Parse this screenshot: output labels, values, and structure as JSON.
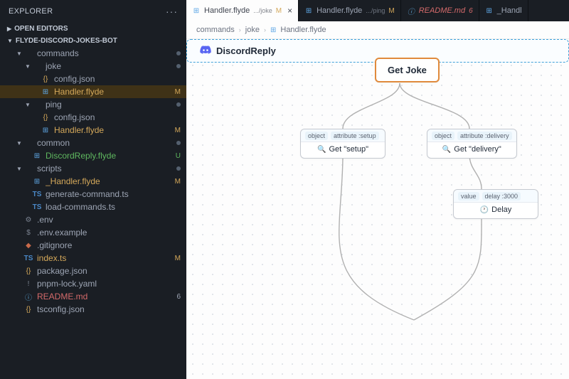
{
  "sidebar": {
    "title": "EXPLORER",
    "openEditors": "OPEN EDITORS",
    "project": "FLYDE-DISCORD-JOKES-BOT",
    "tree": [
      {
        "label": "commands",
        "kind": "folder",
        "indent": 1,
        "open": true,
        "dot": true
      },
      {
        "label": "joke",
        "kind": "folder",
        "indent": 2,
        "open": true,
        "dot": true
      },
      {
        "label": "config.json",
        "kind": "json",
        "indent": 3
      },
      {
        "label": "Handler.flyde",
        "kind": "flyde",
        "indent": 3,
        "status": "M",
        "active": true,
        "mod": true
      },
      {
        "label": "ping",
        "kind": "folder",
        "indent": 2,
        "open": true,
        "dot": true
      },
      {
        "label": "config.json",
        "kind": "json",
        "indent": 3
      },
      {
        "label": "Handler.flyde",
        "kind": "flyde",
        "indent": 3,
        "status": "M",
        "mod": true
      },
      {
        "label": "common",
        "kind": "folder",
        "indent": 1,
        "open": true,
        "dot": true
      },
      {
        "label": "DiscordReply.flyde",
        "kind": "flyde",
        "indent": 2,
        "status": "U",
        "untracked": true
      },
      {
        "label": "scripts",
        "kind": "folder",
        "indent": 1,
        "open": true,
        "dot": true
      },
      {
        "label": "_Handler.flyde",
        "kind": "flyde",
        "indent": 2,
        "status": "M",
        "mod": true
      },
      {
        "label": "generate-command.ts",
        "kind": "ts",
        "indent": 2
      },
      {
        "label": "load-commands.ts",
        "kind": "ts",
        "indent": 2
      },
      {
        "label": ".env",
        "kind": "gear",
        "indent": 1
      },
      {
        "label": ".env.example",
        "kind": "dollar",
        "indent": 1
      },
      {
        "label": ".gitignore",
        "kind": "git",
        "indent": 1
      },
      {
        "label": "index.ts",
        "kind": "ts",
        "indent": 1,
        "status": "M",
        "mod": true
      },
      {
        "label": "package.json",
        "kind": "json",
        "indent": 1
      },
      {
        "label": "pnpm-lock.yaml",
        "kind": "lock",
        "indent": 1
      },
      {
        "label": "README.md",
        "kind": "info",
        "indent": 1,
        "status": "6",
        "deleted": true
      },
      {
        "label": "tsconfig.json",
        "kind": "json",
        "indent": 1
      }
    ]
  },
  "tabs": [
    {
      "icon": "flyde",
      "name": "Handler.flyde",
      "path": ".../joke",
      "mark": "M",
      "markClass": "m-mod",
      "active": true,
      "close": true
    },
    {
      "icon": "flyde",
      "name": "Handler.flyde",
      "path": ".../ping",
      "mark": "M",
      "markClass": "m-mod"
    },
    {
      "icon": "info",
      "name": "README.md",
      "mark": "6",
      "markClass": "m-num",
      "readme": true
    },
    {
      "icon": "flyde",
      "name": "_Handl",
      "trunc": true
    }
  ],
  "breadcrumb": {
    "parts": [
      "commands",
      "joke"
    ],
    "file": "Handler.flyde"
  },
  "nodes": {
    "getJoke": "Get Joke",
    "setup": {
      "ports": [
        "object",
        "attribute :setup"
      ],
      "body": "Get \"setup\""
    },
    "delivery": {
      "ports": [
        "object",
        "attribute :delivery"
      ],
      "body": "Get \"delivery\""
    },
    "delay": {
      "ports": [
        "value",
        "delay :3000"
      ],
      "body": "Delay"
    },
    "discord": "DiscordReply"
  }
}
